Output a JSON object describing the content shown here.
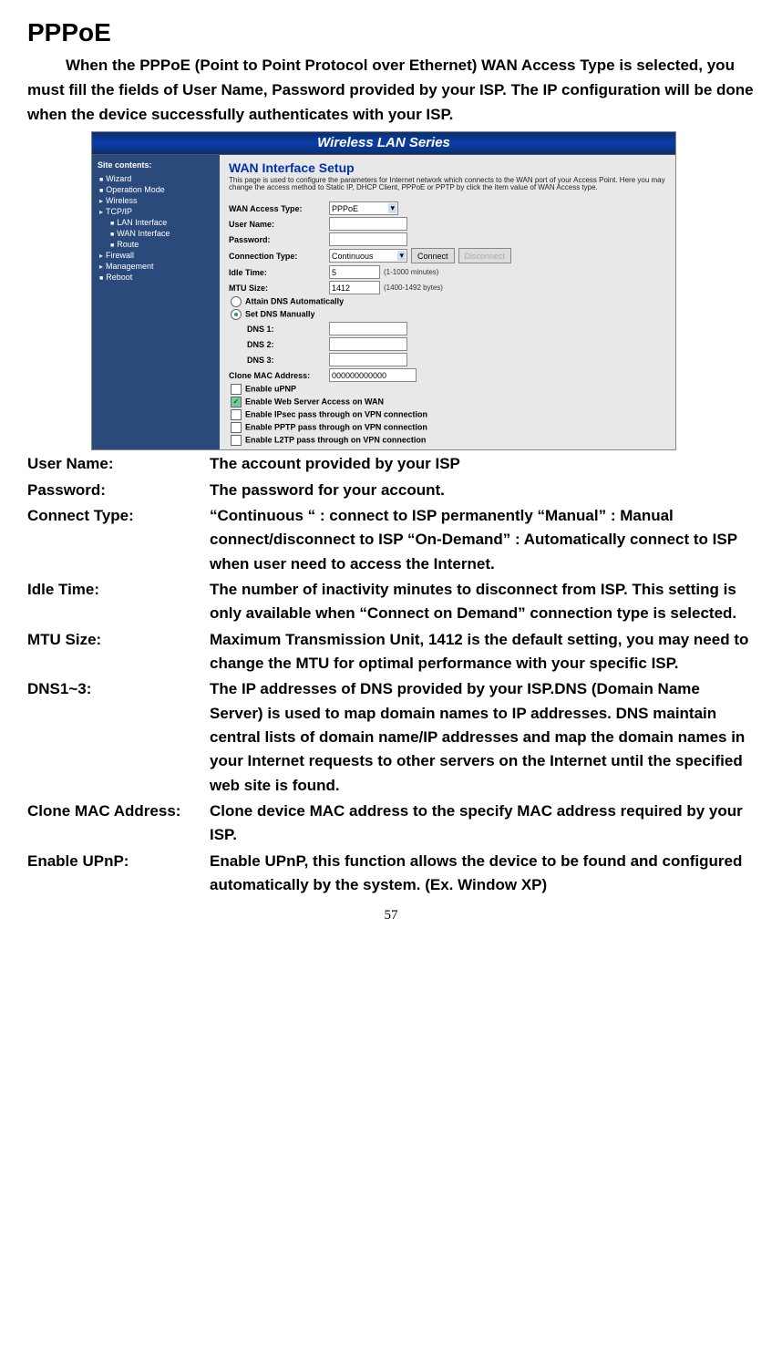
{
  "title": "PPPoE",
  "intro": "When the PPPoE (Point to Point Protocol over Ethernet) WAN Access Type is selected, you must fill the fields of User Name, Password provided by your ISP. The IP configuration will be done when the device successfully authenticates with your ISP.",
  "screenshot": {
    "banner": "Wireless LAN Series",
    "sidebar_title": "Site contents:",
    "sidebar_items": [
      {
        "label": "Wizard",
        "indent": false,
        "doc": true
      },
      {
        "label": "Operation Mode",
        "indent": false,
        "doc": true
      },
      {
        "label": "Wireless",
        "indent": false,
        "doc": false
      },
      {
        "label": "TCP/IP",
        "indent": false,
        "doc": false
      },
      {
        "label": "LAN Interface",
        "indent": true,
        "doc": true
      },
      {
        "label": "WAN Interface",
        "indent": true,
        "doc": true
      },
      {
        "label": "Route",
        "indent": true,
        "doc": true
      },
      {
        "label": "Firewall",
        "indent": false,
        "doc": false
      },
      {
        "label": "Management",
        "indent": false,
        "doc": false
      },
      {
        "label": "Reboot",
        "indent": false,
        "doc": true
      }
    ],
    "page_heading": "WAN Interface Setup",
    "page_desc": "This page is used to configure the parameters for Internet network which connects to the WAN port of your Access Point. Here you may change the access method to Static IP, DHCP Client, PPPoE or PPTP by click the item value of WAN Access type.",
    "fields": {
      "wan_access_type_label": "WAN Access Type:",
      "wan_access_type_value": "PPPoE",
      "user_name_label": "User Name:",
      "user_name_value": "",
      "password_label": "Password:",
      "password_value": "",
      "connection_type_label": "Connection Type:",
      "connection_type_value": "Continuous",
      "connect_btn": "Connect",
      "disconnect_btn": "Disconnect",
      "idle_time_label": "Idle Time:",
      "idle_time_value": "5",
      "idle_time_hint": "(1-1000 minutes)",
      "mtu_label": "MTU Size:",
      "mtu_value": "1412",
      "mtu_hint": "(1400-1492 bytes)",
      "dns_auto": "Attain DNS Automatically",
      "dns_manual": "Set DNS Manually",
      "dns1_label": "DNS 1:",
      "dns2_label": "DNS 2:",
      "dns3_label": "DNS 3:",
      "clone_label": "Clone MAC Address:",
      "clone_value": "000000000000",
      "opt_upnp": "Enable uPNP",
      "opt_web": "Enable Web Server Access on WAN",
      "opt_ipsec": "Enable IPsec pass through on VPN connection",
      "opt_pptp": "Enable PPTP pass through on VPN connection",
      "opt_l2tp": "Enable L2TP pass through on VPN connection"
    }
  },
  "defs": [
    {
      "k": "User Name:",
      "v": "The account provided by your ISP"
    },
    {
      "k": "Password:",
      "v": "The password for your account."
    },
    {
      "k": "Connect Type:",
      "v": "“Continuous “ : connect to ISP permanently “Manual” : Manual connect/disconnect to ISP “On-Demand” : Automatically connect to ISP when user need to access the Internet."
    },
    {
      "k": "Idle Time:",
      "v": "The number of inactivity minutes to disconnect from ISP. This setting is only available when “Connect on Demand” connection type is selected."
    },
    {
      "k": "MTU Size:",
      "v": "Maximum Transmission Unit, 1412 is the default setting, you may need to change the MTU for optimal performance with your specific ISP."
    },
    {
      "k": "DNS1~3:",
      "v": "The IP addresses of DNS provided by your ISP.DNS (Domain Name Server) is used to map domain names to IP addresses. DNS maintain central lists of domain name/IP addresses and map the domain names in your Internet requests to other servers on the Internet until the specified web site is found."
    },
    {
      "k": "Clone MAC Address:",
      "v": "Clone device MAC address to the specify MAC address required by your ISP."
    },
    {
      "k": "Enable UPnP:",
      "v": "Enable UPnP, this function allows the device to be found and configured automatically by the system. (Ex. Window XP)"
    }
  ],
  "page_number": "57"
}
